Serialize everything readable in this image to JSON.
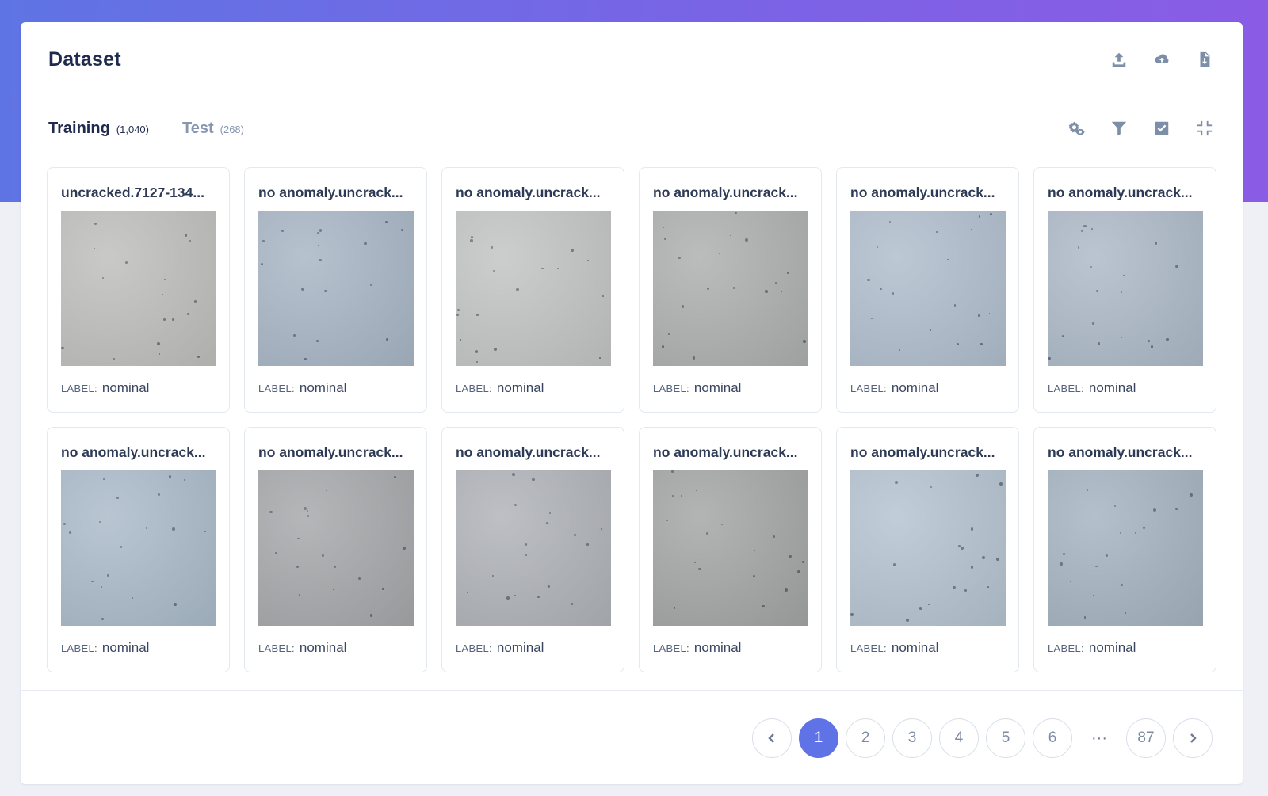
{
  "card": {
    "title": "Dataset"
  },
  "header_actions": [
    {
      "name": "upload-icon"
    },
    {
      "name": "cloud-upload-icon"
    },
    {
      "name": "download-file-icon"
    }
  ],
  "tabs": [
    {
      "label": "Training",
      "count": "(1,040)",
      "active": true
    },
    {
      "label": "Test",
      "count": "(268)",
      "active": false
    }
  ],
  "tool_actions": [
    {
      "name": "view-settings-icon"
    },
    {
      "name": "filter-icon"
    },
    {
      "name": "select-checkbox-icon"
    },
    {
      "name": "collapse-icon"
    }
  ],
  "label_key": "LABEL:",
  "samples": [
    {
      "name": "uncracked.7127-134...",
      "label": "nominal",
      "color": "#bdbdbb"
    },
    {
      "name": "no anomaly.uncrack...",
      "label": "nominal",
      "color": "#a6b4c3"
    },
    {
      "name": "no anomaly.uncrack...",
      "label": "nominal",
      "color": "#c1c2c2"
    },
    {
      "name": "no anomaly.uncrack...",
      "label": "nominal",
      "color": "#acadad"
    },
    {
      "name": "no anomaly.uncrack...",
      "label": "nominal",
      "color": "#aebccb"
    },
    {
      "name": "no anomaly.uncrack...",
      "label": "nominal",
      "color": "#abb8c6"
    },
    {
      "name": "no anomaly.uncrack...",
      "label": "nominal",
      "color": "#a9b9c8"
    },
    {
      "name": "no anomaly.uncrack...",
      "label": "nominal",
      "color": "#a4a6a9"
    },
    {
      "name": "no anomaly.uncrack...",
      "label": "nominal",
      "color": "#aeb1b7"
    },
    {
      "name": "no anomaly.uncrack...",
      "label": "nominal",
      "color": "#a2a3a3"
    },
    {
      "name": "no anomaly.uncrack...",
      "label": "nominal",
      "color": "#b3c2cf"
    },
    {
      "name": "no anomaly.uncrack...",
      "label": "nominal",
      "color": "#a3b2bf"
    }
  ],
  "pagination": {
    "pages": [
      "1",
      "2",
      "3",
      "4",
      "5",
      "6"
    ],
    "ellipsis": "···",
    "last": "87",
    "current": "1"
  }
}
